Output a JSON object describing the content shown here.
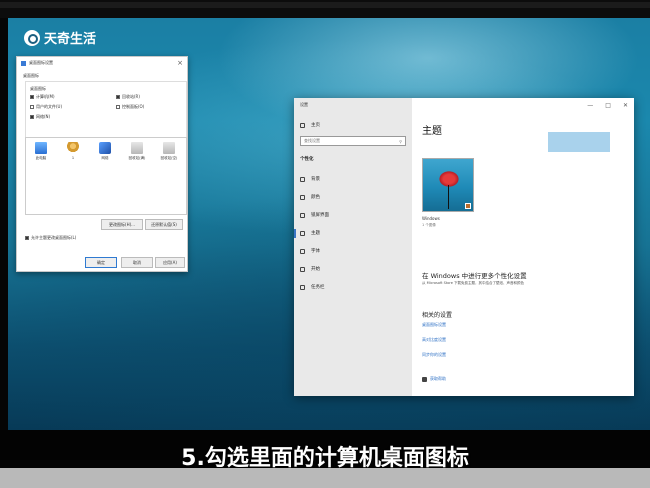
{
  "watermark": "天奇生活",
  "caption": "5.勾选里面的计算机桌面图标",
  "dialog": {
    "title": "桌面图标设置",
    "tab": "桌面图标",
    "group_label": "桌面图标",
    "checkboxes": [
      {
        "label": "计算机(M)",
        "checked": true
      },
      {
        "label": "回收站(R)",
        "checked": true
      },
      {
        "label": "用户的文件(U)",
        "checked": false
      },
      {
        "label": "控制面板(O)",
        "checked": false
      },
      {
        "label": "网络(N)",
        "checked": true
      }
    ],
    "icons": [
      {
        "label": "此电脑",
        "glyph": "computer-icon"
      },
      {
        "label": "1",
        "glyph": "user-icon"
      },
      {
        "label": "网络",
        "glyph": "network-icon"
      },
      {
        "label": "回收站(满)",
        "glyph": "recycle-bin-full-icon"
      },
      {
        "label": "回收站(空)",
        "glyph": "recycle-bin-empty-icon"
      }
    ],
    "change_icon_btn": "更改图标(H)...",
    "restore_default_btn": "还原默认值(S)",
    "allow_themes_label": "允许主题更改桌面图标(L)",
    "ok_btn": "确定",
    "cancel_btn": "取消",
    "apply_btn": "应用(A)"
  },
  "settings": {
    "window_title": "设置",
    "home": "主页",
    "search_placeholder": "查找设置",
    "section": "个性化",
    "nav": [
      {
        "label": "背景"
      },
      {
        "label": "颜色"
      },
      {
        "label": "锁屏界面"
      },
      {
        "label": "主题"
      },
      {
        "label": "字体"
      },
      {
        "label": "开始"
      },
      {
        "label": "任务栏"
      }
    ],
    "main_title": "主题",
    "theme_name": "Windows",
    "theme_count": "1 个图像",
    "more_title": "在 Windows 中进行更多个性化设置",
    "more_sub": "从 Microsoft Store 下载免费主题，其中结合了壁纸、声音和颜色",
    "related_title": "相关的设置",
    "related_links": [
      "桌面图标设置",
      "高对比度设置",
      "同步你的设置"
    ],
    "help": "获取帮助",
    "window_controls": [
      "—",
      "□",
      "✕"
    ]
  }
}
